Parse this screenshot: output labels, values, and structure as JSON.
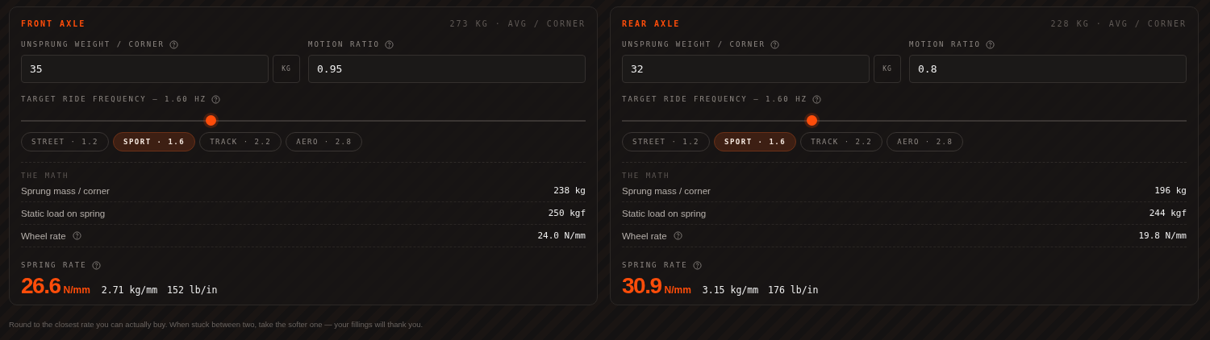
{
  "axles": [
    {
      "title": "FRONT AXLE",
      "summary": "273 KG · AVG / CORNER",
      "unsprung": {
        "label": "UNSPRUNG WEIGHT / CORNER",
        "value": "35",
        "unit": "KG"
      },
      "motion": {
        "label": "MOTION RATIO",
        "value": "0.95"
      },
      "frequency": {
        "label": "TARGET RIDE FREQUENCY — 1.60 HZ",
        "level": 0.336
      },
      "presets": [
        {
          "label": "STREET · 1.2",
          "selected": false
        },
        {
          "label": "SPORT · 1.6",
          "selected": true
        },
        {
          "label": "TRACK · 2.2",
          "selected": false
        },
        {
          "label": "AERO · 2.8",
          "selected": false
        }
      ],
      "math_title": "THE MATH",
      "math": [
        {
          "label": "Sprung mass / corner",
          "value": "238 kg",
          "help": false
        },
        {
          "label": "Static load on spring",
          "value": "250 kgf",
          "help": false
        },
        {
          "label": "Wheel rate",
          "value": "24.0 N/mm",
          "help": true
        }
      ],
      "spring": {
        "label": "SPRING RATE",
        "value": "26.6",
        "unit": "N/mm",
        "alt": [
          "2.71 kg/mm",
          "152 lb/in"
        ]
      }
    },
    {
      "title": "REAR AXLE",
      "summary": "228 KG · AVG / CORNER",
      "unsprung": {
        "label": "UNSPRUNG WEIGHT / CORNER",
        "value": "32",
        "unit": "KG"
      },
      "motion": {
        "label": "MOTION RATIO",
        "value": "0.8"
      },
      "frequency": {
        "label": "TARGET RIDE FREQUENCY — 1.60 HZ",
        "level": 0.335
      },
      "presets": [
        {
          "label": "STREET · 1.2",
          "selected": false
        },
        {
          "label": "SPORT · 1.6",
          "selected": true
        },
        {
          "label": "TRACK · 2.2",
          "selected": false
        },
        {
          "label": "AERO · 2.8",
          "selected": false
        }
      ],
      "math_title": "THE MATH",
      "math": [
        {
          "label": "Sprung mass / corner",
          "value": "196 kg",
          "help": false
        },
        {
          "label": "Static load on spring",
          "value": "244 kgf",
          "help": false
        },
        {
          "label": "Wheel rate",
          "value": "19.8 N/mm",
          "help": true
        }
      ],
      "spring": {
        "label": "SPRING RATE",
        "value": "30.9",
        "unit": "N/mm",
        "alt": [
          "3.15 kg/mm",
          "176 lb/in"
        ]
      }
    }
  ],
  "footnote": "Round to the closest rate you can actually buy. When stuck between two, take the softer one — your fillings will thank you."
}
